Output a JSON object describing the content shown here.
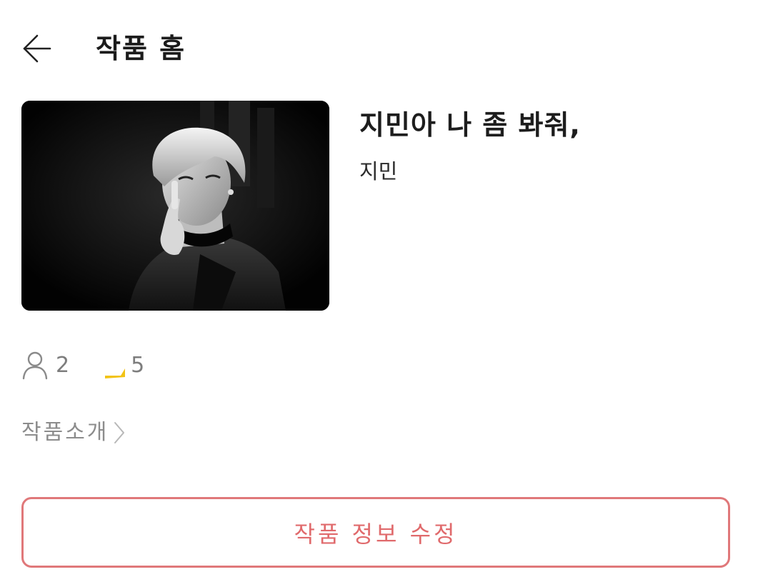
{
  "header": {
    "back_icon": "arrow-left-icon",
    "title": "작품 홈"
  },
  "work": {
    "cover_icon": "cover-image",
    "title": "지민아 나 좀 봐줘,",
    "author": "지민"
  },
  "stats": {
    "readers_icon": "person-icon",
    "readers": "2",
    "likes_icon": "like-icon",
    "likes": "5"
  },
  "intro": {
    "label": "작품소개",
    "icon": "chevron-right-icon"
  },
  "edit_button": {
    "label": "작품 정보 수정"
  },
  "colors": {
    "accent": "#e0787a",
    "accent_text": "#e06a6c",
    "muted_text": "#8c8c8c",
    "like_yellow": "#f2c315"
  }
}
